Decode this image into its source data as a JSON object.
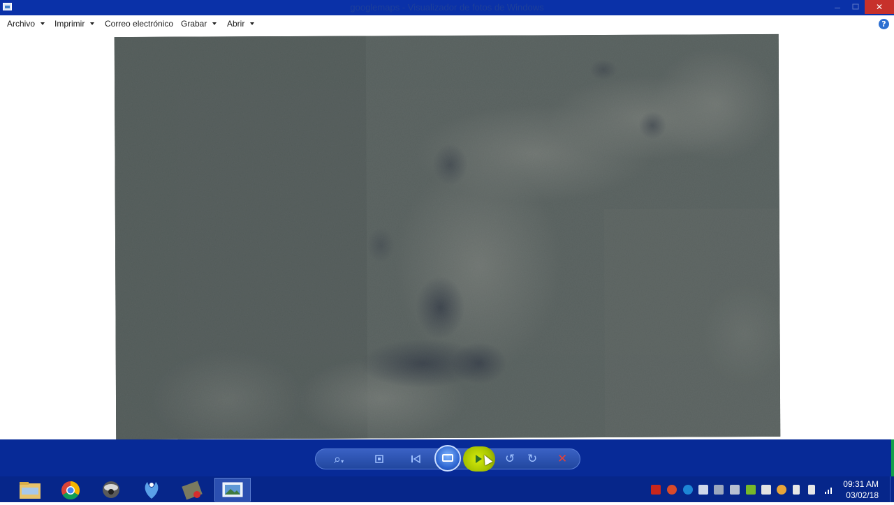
{
  "window": {
    "title": "googlemaps - Visualizador de fotos de Windows",
    "minimize_icon": "minimize-icon",
    "maximize_icon": "maximize-icon",
    "close_glyph": "✕"
  },
  "menu": {
    "items": [
      {
        "label": "Archivo",
        "has_dropdown": true
      },
      {
        "label": "Imprimir",
        "has_dropdown": true
      },
      {
        "label": "Correo electrónico",
        "has_dropdown": false
      },
      {
        "label": "Grabar",
        "has_dropdown": true
      },
      {
        "label": "Abrir",
        "has_dropdown": true
      }
    ],
    "help_glyph": "?"
  },
  "photo": {
    "subject": "satellite terrain image",
    "colors": {
      "dark": "#3a4242",
      "mid": "#58605e",
      "light": "#8a8c86",
      "shadow": "#151b2e"
    }
  },
  "controls": {
    "icons": [
      "zoom-icon",
      "actual-size-icon",
      "previous-icon",
      "slideshow-icon",
      "next-icon",
      "rotate-counterclockwise-icon",
      "rotate-clockwise-icon",
      "delete-icon"
    ],
    "zoom_glyph": "⌕",
    "rotate_ccw_glyph": "↺",
    "rotate_cw_glyph": "↻",
    "delete_glyph": "✕"
  },
  "taskbar": {
    "apps": [
      "file-explorer-icon",
      "chrome-icon",
      "app-icon",
      "app-icon",
      "app-icon",
      "photo-viewer-icon"
    ],
    "active_app": "photo-viewer-icon",
    "clock": {
      "time": "09:31 AM",
      "date": "03/02/18"
    }
  },
  "colors": {
    "titlebar": "#0a31a8",
    "controlbar": "#072a97",
    "taskbar": "#06268a",
    "close": "#c7312b"
  }
}
